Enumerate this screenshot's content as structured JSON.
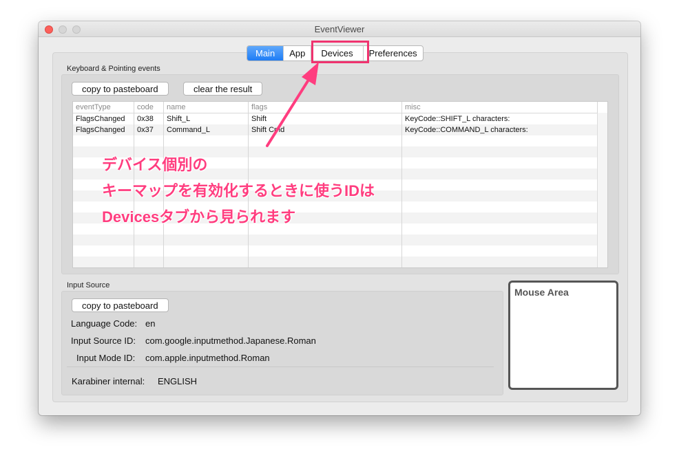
{
  "window": {
    "title": "EventViewer"
  },
  "tabs": [
    {
      "label": "Main",
      "active": true
    },
    {
      "label": "App",
      "active": false
    },
    {
      "label": "Devices",
      "active": false
    },
    {
      "label": "Preferences",
      "active": false
    }
  ],
  "keyboard_section": {
    "label": "Keyboard & Pointing events",
    "copy_button": "copy to pasteboard",
    "clear_button": "clear the result",
    "columns": [
      "eventType",
      "code",
      "name",
      "flags",
      "misc"
    ],
    "rows": [
      [
        "FlagsChanged",
        "0x38",
        "Shift_L",
        "Shift",
        "KeyCode::SHIFT_L    characters:"
      ],
      [
        "FlagsChanged",
        "0x37",
        "Command_L",
        "Shift Cmd",
        "KeyCode::COMMAND_L    characters:"
      ]
    ]
  },
  "input_source": {
    "label": "Input Source",
    "copy_button": "copy to pasteboard",
    "language_code_label": "Language Code:",
    "language_code_value": "en",
    "input_source_id_label": "Input Source ID:",
    "input_source_id_value": "com.google.inputmethod.Japanese.Roman",
    "input_mode_id_label": "Input Mode ID:",
    "input_mode_id_value": "com.apple.inputmethod.Roman",
    "karabiner_internal_label": "Karabiner internal:",
    "karabiner_internal_value": "ENGLISH"
  },
  "mouse_area": {
    "label": "Mouse Area"
  },
  "annotation": {
    "line1": "デバイス個別の",
    "line2": "キーマップを有効化するときに使うIDは",
    "line3": "Devicesタブから見られます",
    "color": "#ff3d7f"
  }
}
